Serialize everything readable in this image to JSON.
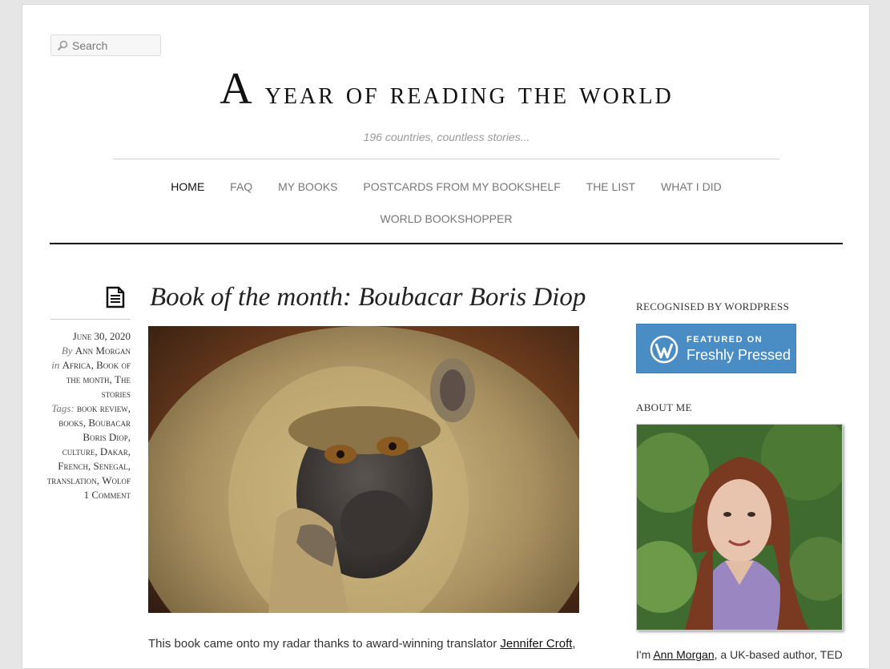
{
  "search": {
    "placeholder": "Search"
  },
  "site": {
    "title_first": "A",
    "title_rest": "year of reading the world",
    "tagline": "196 countries, countless stories..."
  },
  "nav": {
    "items": [
      {
        "label": "Home",
        "current": true
      },
      {
        "label": "FAQ"
      },
      {
        "label": "My books"
      },
      {
        "label": "Postcards from my bookshelf"
      },
      {
        "label": "The list"
      },
      {
        "label": "What I did"
      },
      {
        "label": "World bookshopper"
      }
    ]
  },
  "post": {
    "title": "Book of the month: Boubacar Boris Diop",
    "date": "June 30, 2020",
    "by_label": "By",
    "author": "Ann Morgan",
    "in_label": "in",
    "categories": [
      "Africa",
      "Book of the month",
      "The stories"
    ],
    "tags_label": "Tags:",
    "tags": [
      "book review",
      "books",
      "Boubacar Boris Diop",
      "culture",
      "Dakar",
      "French",
      "Senegal",
      "translation",
      "Wolof"
    ],
    "comments": "1 Comment",
    "excerpt_before": "This book came onto my radar thanks to award-winning translator ",
    "excerpt_link": "Jennifer Croft",
    "excerpt_after": ","
  },
  "sidebar": {
    "recognised_title": "Recognised by WordPress",
    "badge_line1": "Featured on",
    "badge_line2": "Freshly Pressed",
    "about_title": "About me",
    "about_prefix": "I'm ",
    "about_link": "Ann Morgan",
    "about_suffix": ", a UK-based author, TED"
  }
}
